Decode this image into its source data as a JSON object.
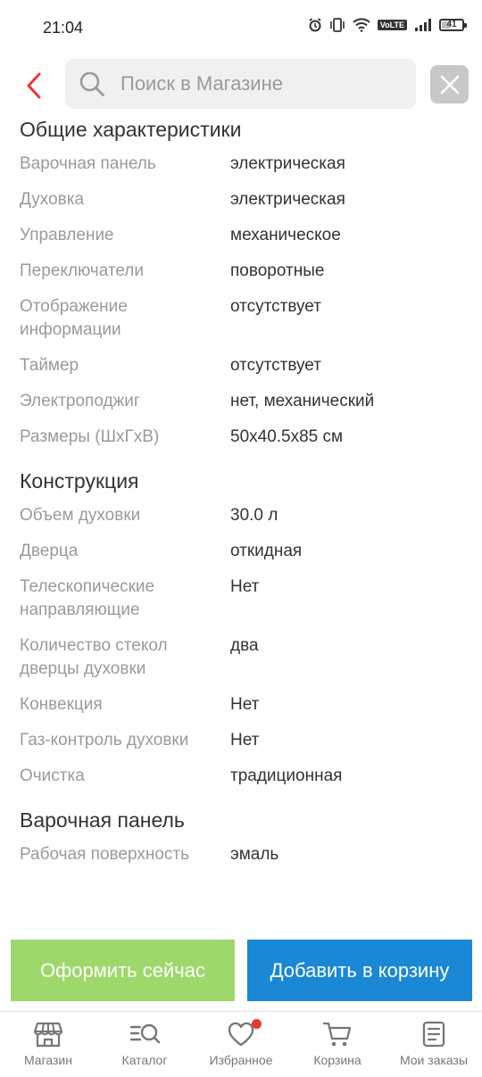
{
  "status": {
    "time": "21:04",
    "volte": "VoLTE",
    "battery": "41"
  },
  "search": {
    "placeholder": "Поиск в Магазине"
  },
  "sections": [
    {
      "title": "Общие характеристики",
      "rows": [
        {
          "label": "Варочная панель",
          "value": "электрическая"
        },
        {
          "label": "Духовка",
          "value": "электрическая"
        },
        {
          "label": "Управление",
          "value": "механическое"
        },
        {
          "label": "Переключатели",
          "value": "поворотные"
        },
        {
          "label": "Отображение информации",
          "value": "отсутствует"
        },
        {
          "label": "Таймер",
          "value": "отсутствует"
        },
        {
          "label": "Электроподжиг",
          "value": "нет, механический"
        },
        {
          "label": "Размеры (ШхГхВ)",
          "value": "50x40.5x85 см"
        }
      ]
    },
    {
      "title": "Конструкция",
      "rows": [
        {
          "label": "Объем духовки",
          "value": "30.0 л"
        },
        {
          "label": "Дверца",
          "value": "откидная"
        },
        {
          "label": "Телескопические направляющие",
          "value": "Нет"
        },
        {
          "label": "Количество стекол дверцы духовки",
          "value": "два"
        },
        {
          "label": "Конвекция",
          "value": "Нет"
        },
        {
          "label": "Газ-контроль духовки",
          "value": "Нет"
        },
        {
          "label": "Очистка",
          "value": "традиционная"
        }
      ]
    },
    {
      "title": "Варочная панель",
      "rows": [
        {
          "label": "Рабочая поверхность",
          "value": "эмаль"
        }
      ]
    }
  ],
  "actions": {
    "checkout": "Оформить сейчас",
    "add_to_cart": "Добавить в корзину"
  },
  "nav": [
    {
      "label": "Магазин",
      "icon": "store-icon"
    },
    {
      "label": "Каталог",
      "icon": "catalog-search-icon"
    },
    {
      "label": "Избранное",
      "icon": "heart-icon"
    },
    {
      "label": "Корзина",
      "icon": "cart-icon"
    },
    {
      "label": "Мои заказы",
      "icon": "orders-icon"
    }
  ],
  "colors": {
    "accent_red": "#e53935",
    "checkout_green": "#9ed86a",
    "cart_blue": "#1a88d4",
    "battery_fill_fraction": 0.41
  }
}
